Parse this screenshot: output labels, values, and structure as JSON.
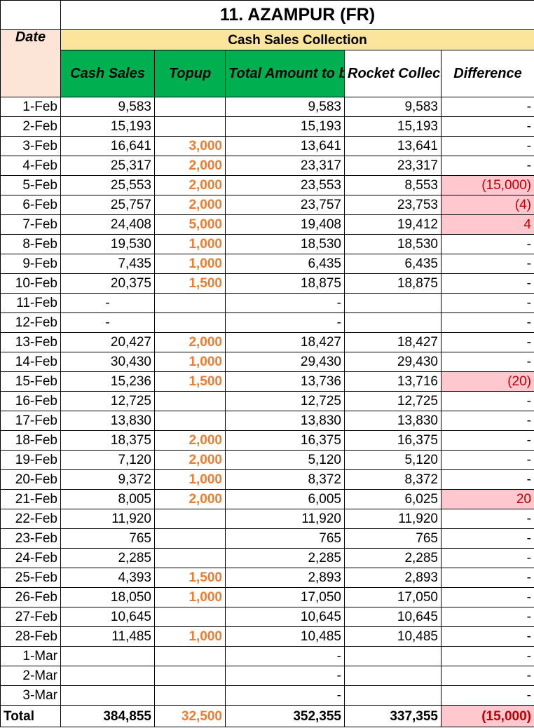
{
  "title": "11. AZAMPUR (FR)",
  "subtitle": "Cash Sales Collection",
  "headers": {
    "date": "Date",
    "cash_sales": "Cash Sales",
    "topup": "Topup",
    "total_amount": "Total Amount to be Deposited",
    "rocket": "Rocket Collection",
    "difference": "Difference"
  },
  "rows": [
    {
      "date": "1-Feb",
      "cash": "9,583",
      "topup": "",
      "total": "9,583",
      "rocket": "9,583",
      "diff": "-",
      "flag": ""
    },
    {
      "date": "2-Feb",
      "cash": "15,193",
      "topup": "",
      "total": "15,193",
      "rocket": "15,193",
      "diff": "-",
      "flag": ""
    },
    {
      "date": "3-Feb",
      "cash": "16,641",
      "topup": "3,000",
      "total": "13,641",
      "rocket": "13,641",
      "diff": "-",
      "flag": ""
    },
    {
      "date": "4-Feb",
      "cash": "25,317",
      "topup": "2,000",
      "total": "23,317",
      "rocket": "23,317",
      "diff": "-",
      "flag": ""
    },
    {
      "date": "5-Feb",
      "cash": "25,553",
      "topup": "2,000",
      "total": "23,553",
      "rocket": "8,553",
      "diff": "(15,000)",
      "flag": "neg"
    },
    {
      "date": "6-Feb",
      "cash": "25,757",
      "topup": "2,000",
      "total": "23,757",
      "rocket": "23,753",
      "diff": "(4)",
      "flag": "neg"
    },
    {
      "date": "7-Feb",
      "cash": "24,408",
      "topup": "5,000",
      "total": "19,408",
      "rocket": "19,412",
      "diff": "4",
      "flag": "pos"
    },
    {
      "date": "8-Feb",
      "cash": "19,530",
      "topup": "1,000",
      "total": "18,530",
      "rocket": "18,530",
      "diff": "-",
      "flag": ""
    },
    {
      "date": "9-Feb",
      "cash": "7,435",
      "topup": "1,000",
      "total": "6,435",
      "rocket": "6,435",
      "diff": "-",
      "flag": ""
    },
    {
      "date": "10-Feb",
      "cash": "20,375",
      "topup": "1,500",
      "total": "18,875",
      "rocket": "18,875",
      "diff": "-",
      "flag": ""
    },
    {
      "date": "11-Feb",
      "cash": "-",
      "topup": "",
      "total": "-",
      "rocket": "",
      "diff": "-",
      "flag": ""
    },
    {
      "date": "12-Feb",
      "cash": "-",
      "topup": "",
      "total": "-",
      "rocket": "",
      "diff": "-",
      "flag": ""
    },
    {
      "date": "13-Feb",
      "cash": "20,427",
      "topup": "2,000",
      "total": "18,427",
      "rocket": "18,427",
      "diff": "-",
      "flag": ""
    },
    {
      "date": "14-Feb",
      "cash": "30,430",
      "topup": "1,000",
      "total": "29,430",
      "rocket": "29,430",
      "diff": "-",
      "flag": ""
    },
    {
      "date": "15-Feb",
      "cash": "15,236",
      "topup": "1,500",
      "total": "13,736",
      "rocket": "13,716",
      "diff": "(20)",
      "flag": "neg"
    },
    {
      "date": "16-Feb",
      "cash": "12,725",
      "topup": "",
      "total": "12,725",
      "rocket": "12,725",
      "diff": "-",
      "flag": ""
    },
    {
      "date": "17-Feb",
      "cash": "13,830",
      "topup": "",
      "total": "13,830",
      "rocket": "13,830",
      "diff": "-",
      "flag": ""
    },
    {
      "date": "18-Feb",
      "cash": "18,375",
      "topup": "2,000",
      "total": "16,375",
      "rocket": "16,375",
      "diff": "-",
      "flag": ""
    },
    {
      "date": "19-Feb",
      "cash": "7,120",
      "topup": "2,000",
      "total": "5,120",
      "rocket": "5,120",
      "diff": "-",
      "flag": ""
    },
    {
      "date": "20-Feb",
      "cash": "9,372",
      "topup": "1,000",
      "total": "8,372",
      "rocket": "8,372",
      "diff": "-",
      "flag": ""
    },
    {
      "date": "21-Feb",
      "cash": "8,005",
      "topup": "2,000",
      "total": "6,005",
      "rocket": "6,025",
      "diff": "20",
      "flag": "pos"
    },
    {
      "date": "22-Feb",
      "cash": "11,920",
      "topup": "",
      "total": "11,920",
      "rocket": "11,920",
      "diff": "-",
      "flag": ""
    },
    {
      "date": "23-Feb",
      "cash": "765",
      "topup": "",
      "total": "765",
      "rocket": "765",
      "diff": "-",
      "flag": ""
    },
    {
      "date": "24-Feb",
      "cash": "2,285",
      "topup": "",
      "total": "2,285",
      "rocket": "2,285",
      "diff": "-",
      "flag": ""
    },
    {
      "date": "25-Feb",
      "cash": "4,393",
      "topup": "1,500",
      "total": "2,893",
      "rocket": "2,893",
      "diff": "-",
      "flag": ""
    },
    {
      "date": "26-Feb",
      "cash": "18,050",
      "topup": "1,000",
      "total": "17,050",
      "rocket": "17,050",
      "diff": "-",
      "flag": ""
    },
    {
      "date": "27-Feb",
      "cash": "10,645",
      "topup": "",
      "total": "10,645",
      "rocket": "10,645",
      "diff": "-",
      "flag": ""
    },
    {
      "date": "28-Feb",
      "cash": "11,485",
      "topup": "1,000",
      "total": "10,485",
      "rocket": "10,485",
      "diff": "-",
      "flag": ""
    },
    {
      "date": "1-Mar",
      "cash": "",
      "topup": "",
      "total": "-",
      "rocket": "",
      "diff": "-",
      "flag": ""
    },
    {
      "date": "2-Mar",
      "cash": "",
      "topup": "",
      "total": "-",
      "rocket": "",
      "diff": "-",
      "flag": ""
    },
    {
      "date": "3-Mar",
      "cash": "",
      "topup": "",
      "total": "-",
      "rocket": "",
      "diff": "-",
      "flag": ""
    }
  ],
  "totals": {
    "label": "Total",
    "cash": "384,855",
    "topup": "32,500",
    "total": "352,355",
    "rocket": "337,355",
    "diff": "(15,000)"
  },
  "colors": {
    "header_green": "#00b050",
    "subtitle_yellow": "#fbe49c",
    "date_header_peach": "#fce4d6",
    "topup_orange": "#ed7d31",
    "negative_fill": "#ffc7ce",
    "negative_text": "#c00000"
  }
}
